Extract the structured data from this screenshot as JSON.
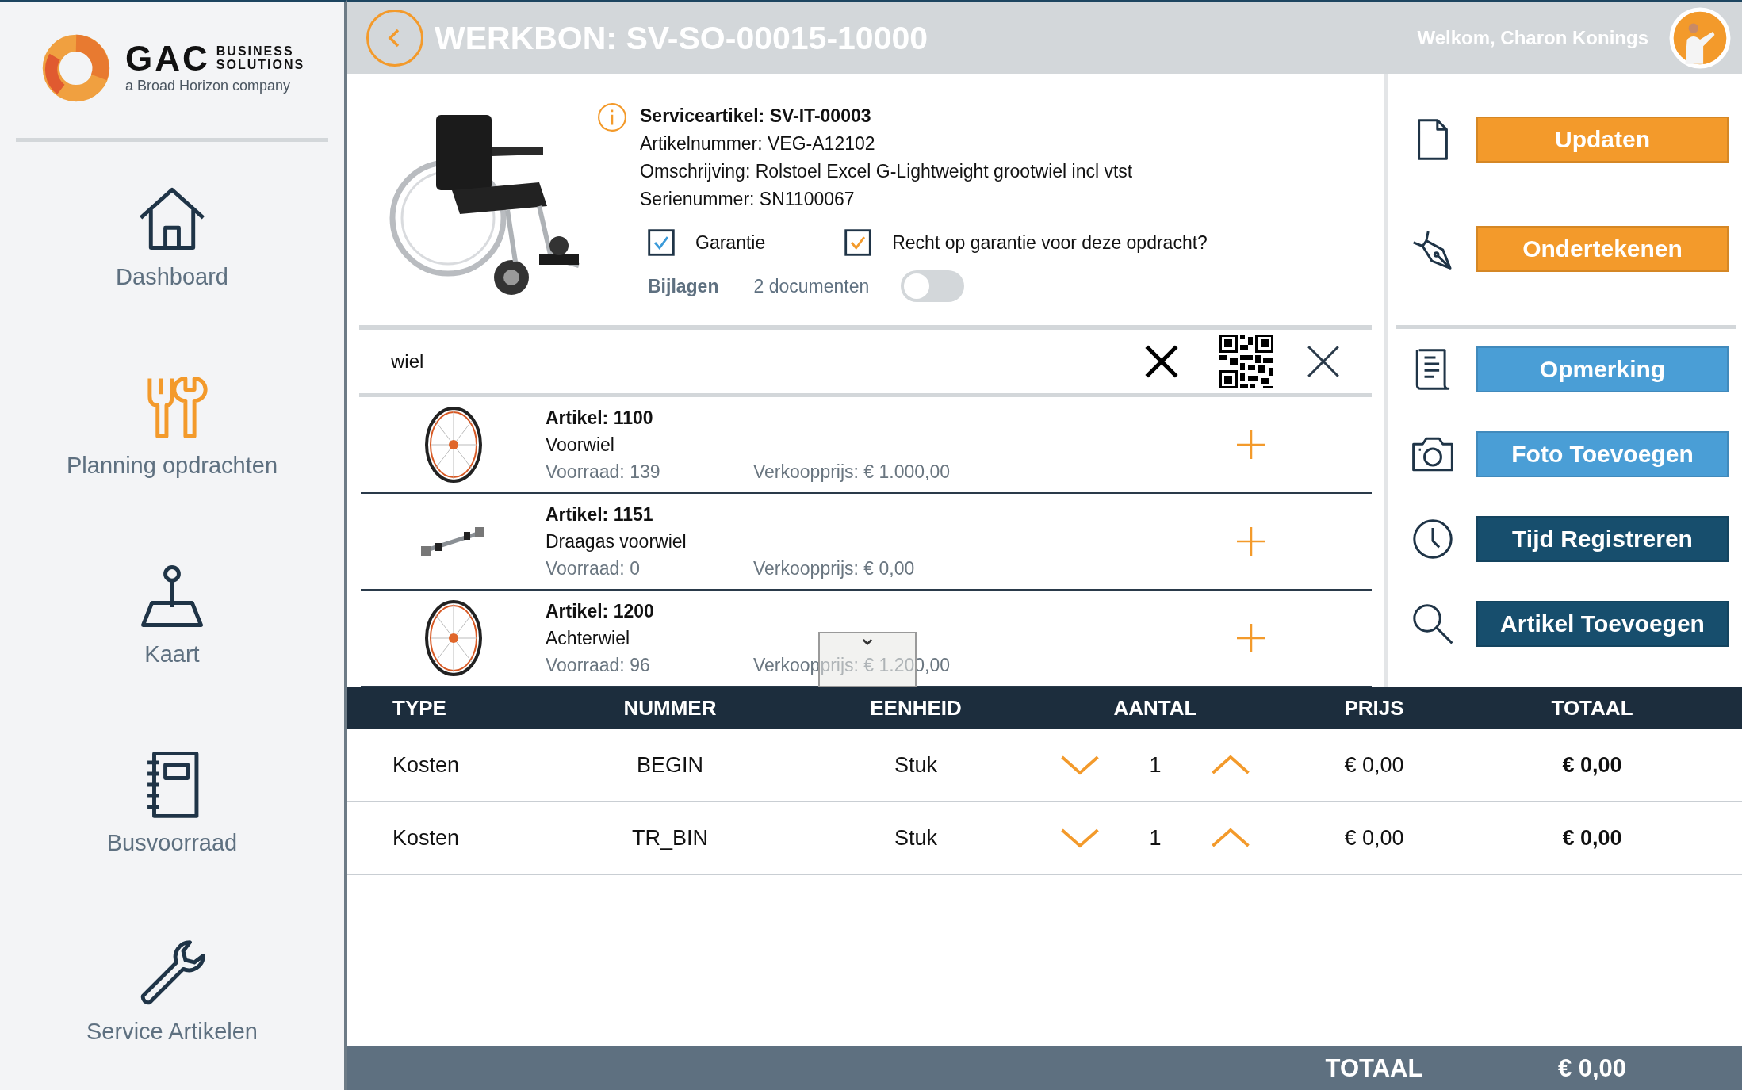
{
  "sidebar": {
    "logo": {
      "name": "GAC",
      "line1": "BUSINESS",
      "line2": "SOLUTIONS",
      "tagline": "a Broad Horizon company"
    },
    "items": [
      {
        "label": "Dashboard",
        "kind": "home",
        "selected": false
      },
      {
        "label": "Planning opdrachten",
        "kind": "tools",
        "selected": true
      },
      {
        "label": "Kaart",
        "kind": "map",
        "selected": false
      },
      {
        "label": "Busvoorraad",
        "kind": "notebook",
        "selected": false
      },
      {
        "label": "Service Artikelen",
        "kind": "wrench",
        "selected": false
      }
    ]
  },
  "header": {
    "title": "WERKBON: SV-SO-00015-10000",
    "welcome": "Welkom, Charon Konings"
  },
  "service_item": {
    "title": "Serviceartikel: SV-IT-00003",
    "lines": [
      "Artikelnummer: VEG-A12102",
      "Omschrijving: Rolstoel Excel G-Lightweight grootwiel incl vtst",
      "Serienummer: SN1100067"
    ],
    "checkboxes": [
      {
        "label": "Garantie",
        "checked": true,
        "color": "#3a9ad9"
      },
      {
        "label": "Recht op garantie voor deze opdracht?",
        "checked": true,
        "color": "#f39a2b"
      }
    ],
    "attachments": {
      "label": "Bijlagen",
      "count": "2 documenten",
      "on": false
    }
  },
  "search": {
    "value": "wiel"
  },
  "results": [
    {
      "title": "Artikel: 1100",
      "name": "Voorwiel",
      "stock": "Voorraad: 139",
      "price": "Verkoopprijs: € 1.000,00"
    },
    {
      "title": "Artikel: 1151",
      "name": "Draagas voorwiel",
      "stock": "Voorraad: 0",
      "price": "Verkoopprijs: € 0,00"
    },
    {
      "title": "Artikel: 1200",
      "name": "Achterwiel",
      "stock": "Voorraad: 96",
      "price": "Verkoopprijs: € 1.200,00"
    }
  ],
  "actions": [
    {
      "label": "Updaten",
      "kind": "document",
      "color": "#f39a2b"
    },
    {
      "label": "Ondertekenen",
      "kind": "pen",
      "color": "#f39a2b"
    },
    {
      "label": "Opmerking",
      "kind": "note",
      "color": "#4a9ed6"
    },
    {
      "label": "Foto Toevoegen",
      "kind": "camera",
      "color": "#4a9ed6"
    },
    {
      "label": "Tijd Registreren",
      "kind": "clock",
      "color": "#174e6d"
    },
    {
      "label": "Artikel Toevoegen",
      "kind": "search",
      "color": "#174e6d"
    }
  ],
  "table": {
    "columns": [
      "TYPE",
      "NUMMER",
      "EENHEID",
      "AANTAL",
      "PRIJS",
      "TOTAAL"
    ],
    "rows": [
      {
        "type": "Kosten",
        "number": "BEGIN",
        "unit": "Stuk",
        "quantity": "1",
        "price": "€ 0,00",
        "total": "€ 0,00"
      },
      {
        "type": "Kosten",
        "number": "TR_BIN",
        "unit": "Stuk",
        "quantity": "1",
        "price": "€ 0,00",
        "total": "€ 0,00"
      }
    ]
  },
  "footer": {
    "label": "TOTAAL",
    "total": "€ 0,00"
  }
}
